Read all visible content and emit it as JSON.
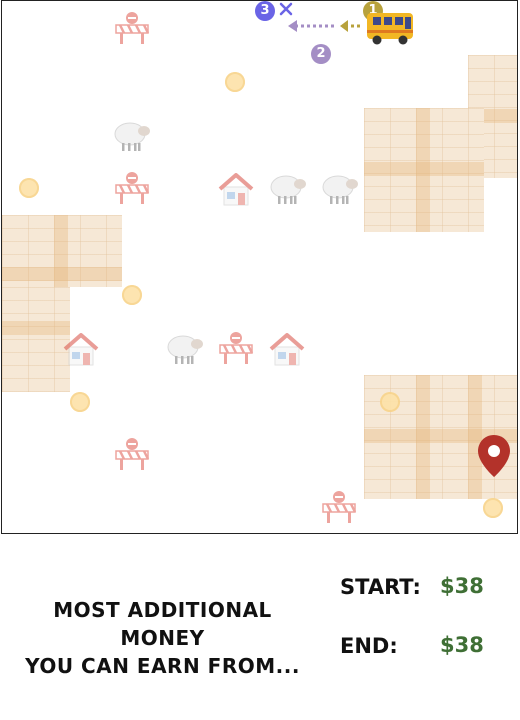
{
  "board": {
    "icons": {
      "bus": "school-bus-icon",
      "destination": "location-pin-icon",
      "house": "house-icon",
      "sheep": "sheep-icon",
      "roadblock": "roadblock-icon",
      "coin": "coin-icon",
      "close": "close-icon"
    },
    "step_badges": [
      "1",
      "2",
      "3"
    ],
    "colors": {
      "bus": "#f2b724",
      "pin": "#b3322a",
      "badge_1": "#b8a23c",
      "badge_2": "#a48ec5",
      "badge_3": "#6a64e6",
      "brick": "#f6e8d6",
      "money_green": "#3f6f35"
    }
  },
  "footer": {
    "question_line1": "MOST ADDITIONAL MONEY",
    "question_line2": "YOU CAN EARN FROM...",
    "start_label": "START:",
    "start_value": "$38",
    "end_label": "END:",
    "end_value": "$38"
  }
}
